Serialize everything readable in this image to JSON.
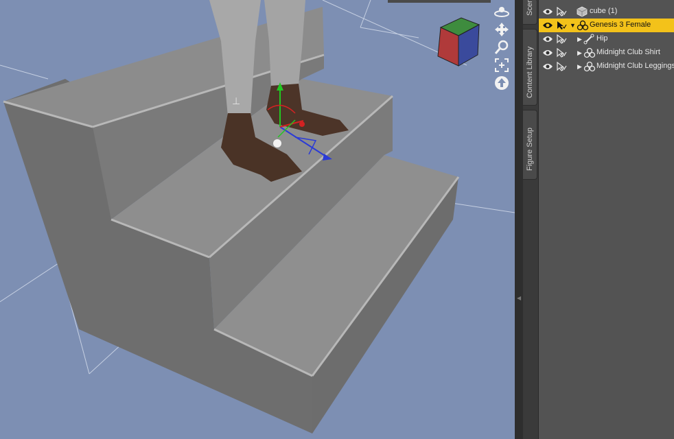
{
  "scene": {
    "items": [
      {
        "label": "cube (1)",
        "type": "primitive"
      },
      {
        "label": "Genesis 3 Female",
        "type": "figure",
        "selected": true,
        "expanded": true
      },
      {
        "label": "Hip",
        "type": "bone",
        "expanded": false
      },
      {
        "label": "Midnight Club Shirt",
        "type": "figure",
        "expanded": false
      },
      {
        "label": "Midnight Club Leggings",
        "type": "figure",
        "expanded": false
      }
    ]
  },
  "side_tabs": [
    {
      "label": "Scene",
      "icon": "scene-tab"
    },
    {
      "label": "Content Library",
      "icon": "content-library-tab"
    },
    {
      "label": "Figure Setup",
      "icon": "figure-setup-tab"
    }
  ],
  "nav_controls": [
    "orbit-icon",
    "pan-icon",
    "zoom-icon",
    "frame-icon",
    "reset-view-icon"
  ],
  "colors": {
    "viewport_bg": "#7d8fb3",
    "stairs_top": "#8e8e8e",
    "stairs_side": "#6f6f6f",
    "selection": "#f3c21a",
    "panel_bg": "#535353",
    "skin": "#4b3427",
    "leggings": "#a7a7a7"
  }
}
